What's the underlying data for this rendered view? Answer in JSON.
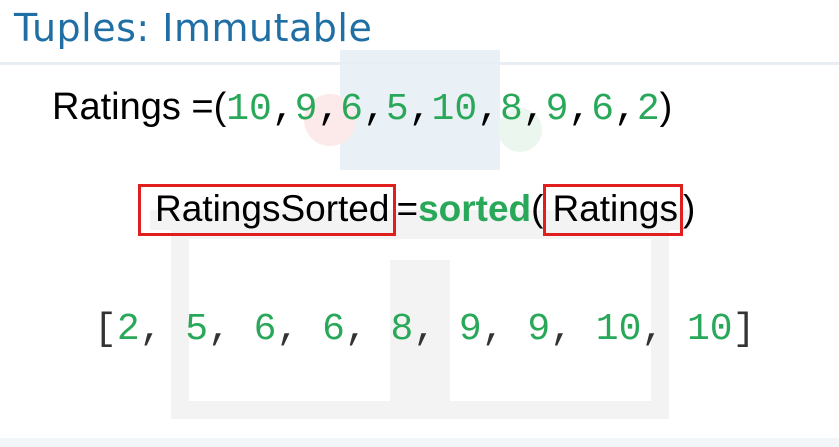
{
  "slide": {
    "title": "Tuples: Immutable"
  },
  "tuple": {
    "name": "Ratings",
    "assign": " =(",
    "values": [
      "10",
      "9",
      "6",
      "5",
      "10",
      "8",
      "9",
      "6",
      "2"
    ],
    "close": ")"
  },
  "sorted_stmt": {
    "target": "RatingsSorted",
    "equals": "=",
    "function": "sorted",
    "open_paren": "(",
    "argument": "Ratings",
    "close_paren": ")"
  },
  "result": {
    "open": "[",
    "values": [
      "2",
      "5",
      "6",
      "6",
      "8",
      "9",
      "9",
      "10",
      "10"
    ],
    "close": "]"
  },
  "colors": {
    "title": "#1f6fa5",
    "number": "#2aa85a",
    "highlight_box": "#e01e1e"
  }
}
